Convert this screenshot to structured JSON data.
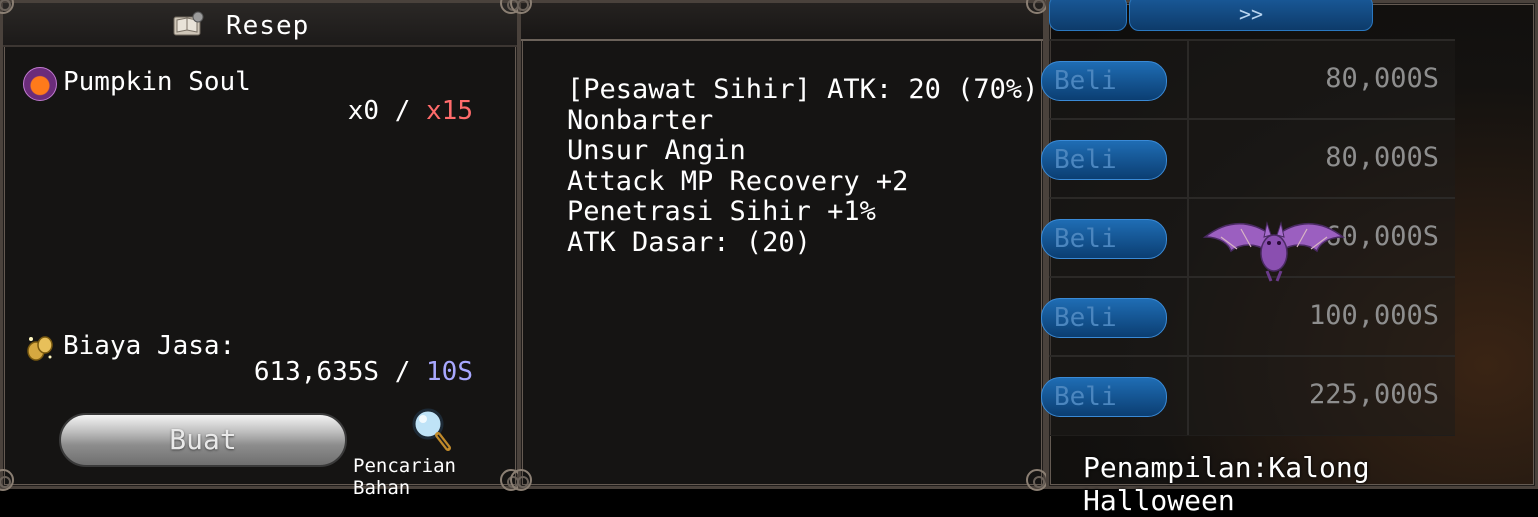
{
  "recipe": {
    "title": "Resep",
    "item_name": "Pumpkin Soul",
    "owned": "x0",
    "separator": " / ",
    "required": "x15",
    "fee_label": "Biaya Jasa:",
    "fee_owned": "613,635S",
    "fee_cost": "10S",
    "make_button": "Buat",
    "search_label": "Pencarian Bahan"
  },
  "details": {
    "lines": [
      "[Pesawat Sihir] ATK: 20 (70%)",
      "Nonbarter",
      "Unsur Angin",
      "Attack MP Recovery +2",
      "Penetrasi Sihir +1%",
      "ATK Dasar: (20)"
    ]
  },
  "shop": {
    "tab_next": ">>",
    "rows": [
      {
        "button": "Beli",
        "price": "80,000S"
      },
      {
        "button": "Beli",
        "price": "80,000S"
      },
      {
        "button": "Beli",
        "price": "60,000S"
      },
      {
        "button": "Beli",
        "price": "100,000S"
      },
      {
        "button": "Beli",
        "price": "225,000S"
      }
    ],
    "appearance": "Penampilan:Kalong Halloween"
  },
  "colors": {
    "required_red": "#ff6b6b",
    "cost_blue": "#a8a8ff",
    "button_blue": "#1f6db4"
  }
}
